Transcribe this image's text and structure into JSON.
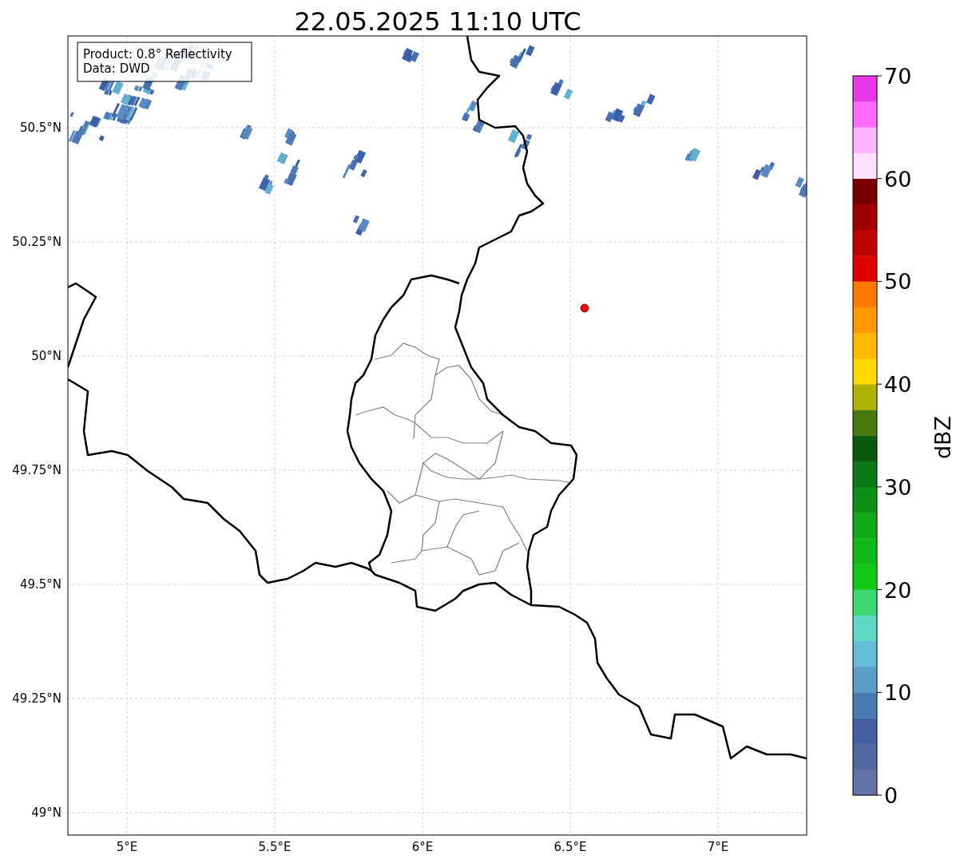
{
  "title": "22.05.2025 11:10 UTC",
  "annotation": [
    "Product: 0.8° Reflectivity",
    "Data: DWD"
  ],
  "map": {
    "lat_labels": [
      "50.5°N",
      "50.25°N",
      "50°N",
      "49.75°N",
      "49.5°N",
      "49.25°N",
      "49°N"
    ],
    "lon_labels": [
      "5°E",
      "5.5°E",
      "6°E",
      "6.5°E",
      "7°E"
    ]
  },
  "colorbar": {
    "label": "dBZ",
    "ticks": [
      "70",
      "60",
      "50",
      "40",
      "30",
      "20",
      "10",
      "0"
    ],
    "bins": [
      {
        "color": "#6474a6"
      },
      {
        "color": "#5468a0"
      },
      {
        "color": "#4560a2"
      },
      {
        "color": "#4a7ab2"
      },
      {
        "color": "#5a9ec8"
      },
      {
        "color": "#64bcd8"
      },
      {
        "color": "#60d8c4"
      },
      {
        "color": "#3cd670"
      },
      {
        "color": "#10c818"
      },
      {
        "color": "#10b818"
      },
      {
        "color": "#10a818"
      },
      {
        "color": "#0c9018"
      },
      {
        "color": "#0c7818"
      },
      {
        "color": "#0a5a10"
      },
      {
        "color": "#487810"
      },
      {
        "color": "#b0b000"
      },
      {
        "color": "#ffd800"
      },
      {
        "color": "#ffb800"
      },
      {
        "color": "#ff9800"
      },
      {
        "color": "#ff7800"
      },
      {
        "color": "#e00000"
      },
      {
        "color": "#c00000"
      },
      {
        "color": "#a00000"
      },
      {
        "color": "#780000"
      },
      {
        "color": "#ffe0ff"
      },
      {
        "color": "#ffb4ff"
      },
      {
        "color": "#ff6cff"
      },
      {
        "color": "#e838e8"
      }
    ]
  }
}
